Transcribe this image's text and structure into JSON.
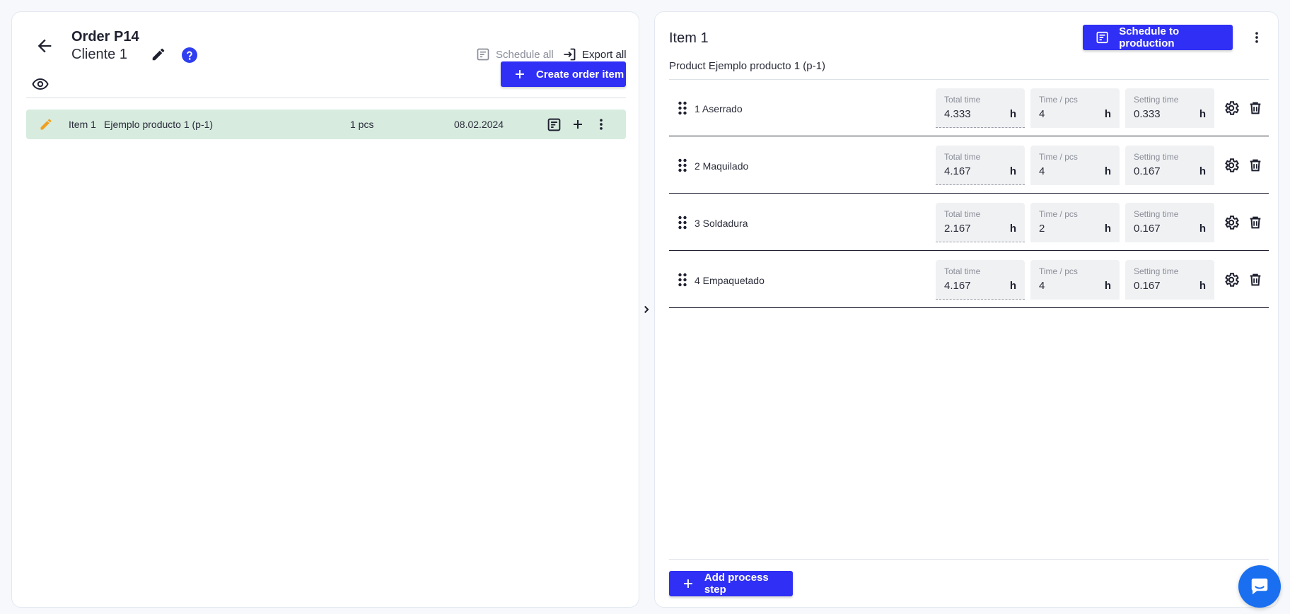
{
  "order": {
    "title": "Order P14",
    "client": "Cliente 1",
    "schedule_all_label": "Schedule all",
    "export_all_label": "Export all",
    "create_item_label": "Create order item",
    "items": [
      {
        "label": "Item 1",
        "product": "Ejemplo producto 1 (p-1)",
        "quantity": "1 pcs",
        "date": "08.02.2024"
      }
    ]
  },
  "detail": {
    "title": "Item 1",
    "schedule_label": "Schedule to production",
    "product_line": "Product Ejemplo producto 1 (p-1)",
    "field_labels": {
      "total": "Total time",
      "per_pcs": "Time / pcs",
      "setting": "Setting time",
      "unit": "h"
    },
    "steps": [
      {
        "name": "1 Aserrado",
        "total": "4.333",
        "per_pcs": "4",
        "setting": "0.333"
      },
      {
        "name": "2 Maquilado",
        "total": "4.167",
        "per_pcs": "4",
        "setting": "0.167"
      },
      {
        "name": "3 Soldadura",
        "total": "2.167",
        "per_pcs": "2",
        "setting": "0.167"
      },
      {
        "name": "4 Empaquetado",
        "total": "4.167",
        "per_pcs": "4",
        "setting": "0.167"
      }
    ],
    "add_step_label": "Add process step"
  },
  "icons": {
    "back": "arrow-left-icon",
    "edit": "pencil-icon",
    "help": "question-icon",
    "view": "eye-icon",
    "schedule": "schedule-icon",
    "export": "export-icon",
    "add": "plus-icon",
    "more": "more-vertical-icon",
    "drag": "drag-handle-icon",
    "settings": "gear-icon",
    "delete": "trash-icon",
    "chat": "chat-icon",
    "expand": "chevron-right-icon"
  },
  "colors": {
    "primary": "#2f2ff5",
    "row_highlight": "#d7ebdf",
    "edit_accent": "#f0a020",
    "help_accent": "#2f3ff0",
    "chat": "#1a6ff0"
  }
}
